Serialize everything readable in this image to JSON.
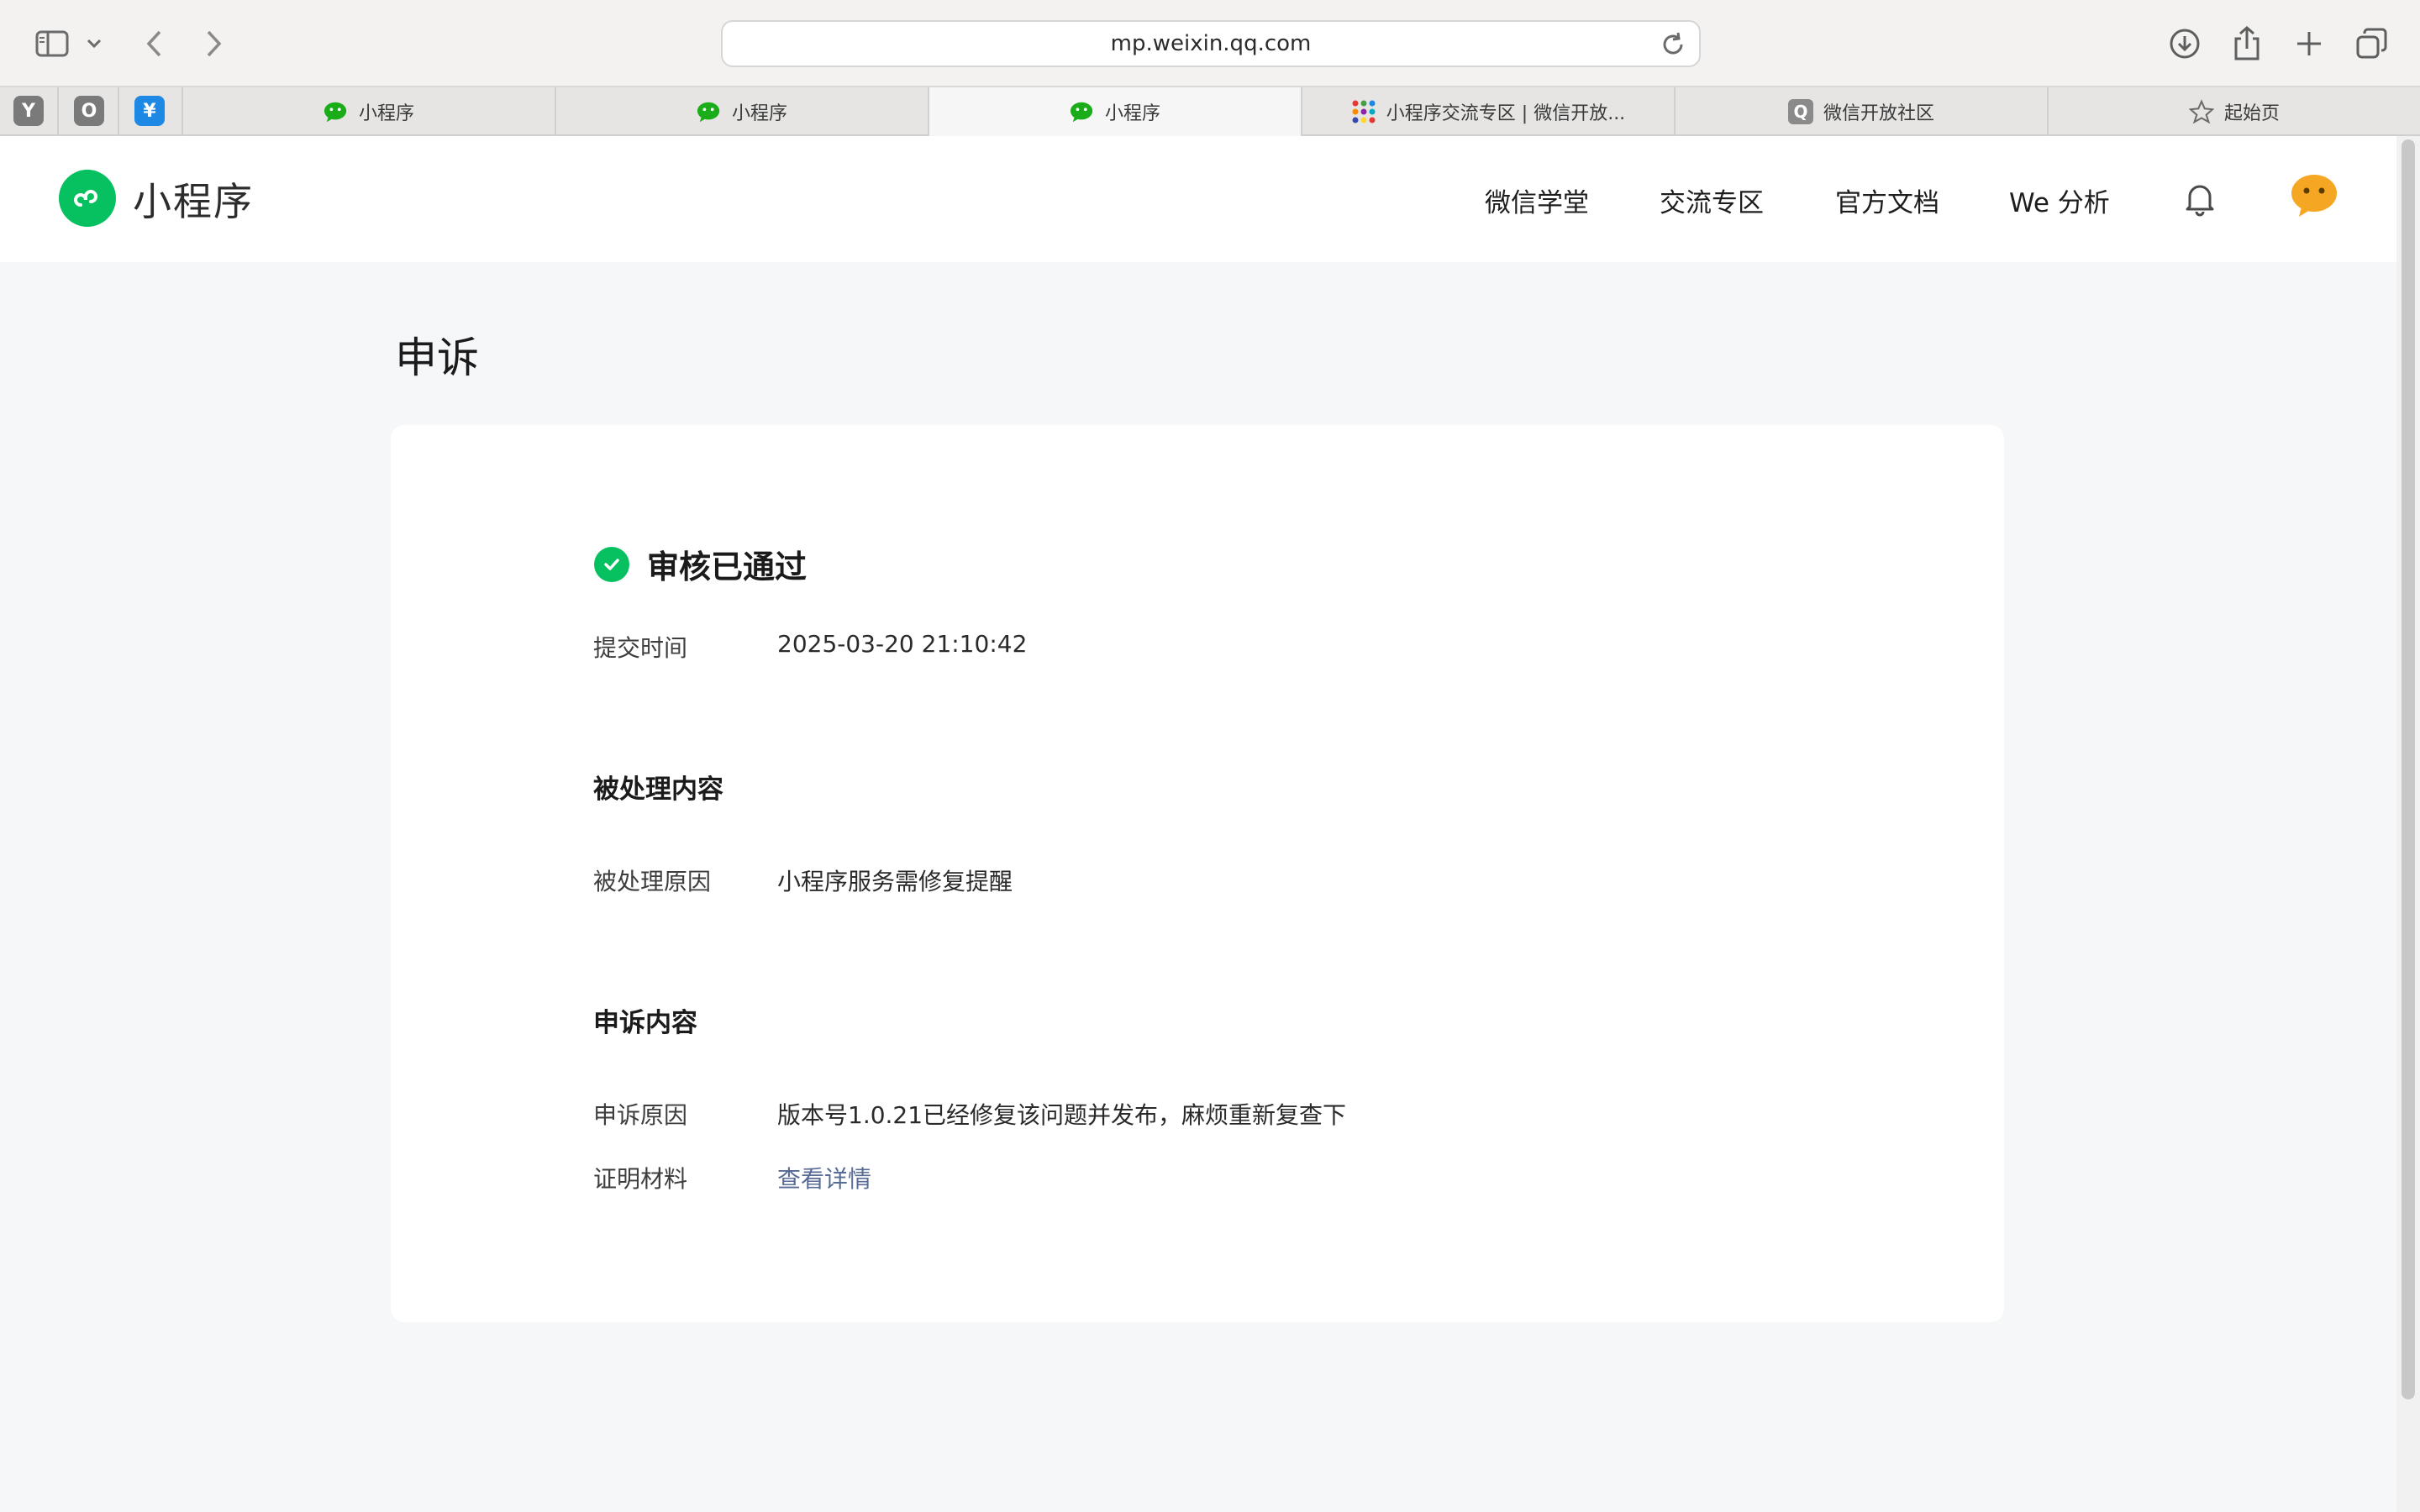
{
  "browser": {
    "url": "mp.weixin.qq.com",
    "pinned": [
      {
        "letter": "Y",
        "color": "#7a7a7a"
      },
      {
        "letter": "O",
        "color": "#7a7a7a"
      },
      {
        "letter": "¥",
        "color": "#1e88e5"
      }
    ],
    "tabs": [
      {
        "title": "小程序",
        "icon": "wechat-icon"
      },
      {
        "title": "小程序",
        "icon": "wechat-icon"
      },
      {
        "title": "小程序",
        "icon": "wechat-icon",
        "active": true
      },
      {
        "title": "小程序交流专区 | 微信开放...",
        "icon": "grid-dots-icon"
      },
      {
        "title": "微信开放社区",
        "icon": "q-icon",
        "icon_letter": "Q"
      },
      {
        "title": "起始页",
        "icon": "star-icon"
      }
    ]
  },
  "header": {
    "brand": "小程序",
    "nav": [
      "微信学堂",
      "交流专区",
      "官方文档",
      "We 分析"
    ]
  },
  "page": {
    "title": "申诉",
    "status": "审核已通过",
    "submit_label": "提交时间",
    "submit_time": "2025-03-20 21:10:42",
    "handled_section": "被处理内容",
    "handled_reason_label": "被处理原因",
    "handled_reason": "小程序服务需修复提醒",
    "appeal_section": "申诉内容",
    "appeal_reason_label": "申诉原因",
    "appeal_reason": "版本号1.0.21已经修复该问题并发布，麻烦重新复查下",
    "evidence_label": "证明材料",
    "evidence_link": "查看详情"
  },
  "colors": {
    "accent_green": "#07c160",
    "link_blue": "#576b95",
    "page_bg": "#f6f7f9",
    "avatar_orange": "#f5a623"
  }
}
